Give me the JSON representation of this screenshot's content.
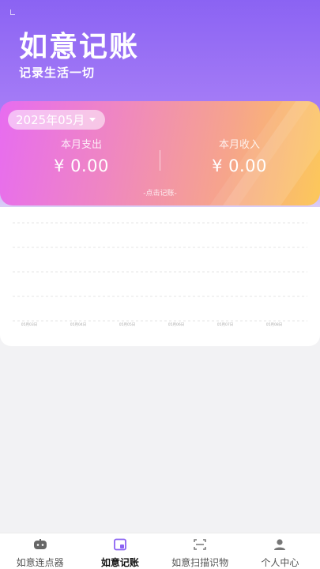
{
  "app": {
    "title": "如意记账",
    "subtitle": "记录生活一切"
  },
  "summary": {
    "month": "2025年05月",
    "expense_label": "本月支出",
    "expense_value": "¥ 0.00",
    "income_label": "本月收入",
    "income_value": "¥ 0.00",
    "hint": "-点击记账-"
  },
  "chart_data": {
    "type": "line",
    "categories": [
      "05月03日",
      "05月04日",
      "05月05日",
      "05月06日",
      "05月07日",
      "05月08日"
    ],
    "series": [
      {
        "values": [
          0,
          0,
          0,
          0,
          0,
          0
        ]
      }
    ],
    "grid": true
  },
  "tabbar": {
    "items": [
      {
        "label": "如意连点器",
        "icon": "gamepad-icon",
        "active": false
      },
      {
        "label": "如意记账",
        "icon": "ledger-icon",
        "active": true
      },
      {
        "label": "如意扫描识物",
        "icon": "scan-icon",
        "active": false
      },
      {
        "label": "个人中心",
        "icon": "user-icon",
        "active": false
      }
    ]
  },
  "colors": {
    "accent": "#8b63f3",
    "card_start": "#e76cf0",
    "card_end": "#fcc85a"
  }
}
